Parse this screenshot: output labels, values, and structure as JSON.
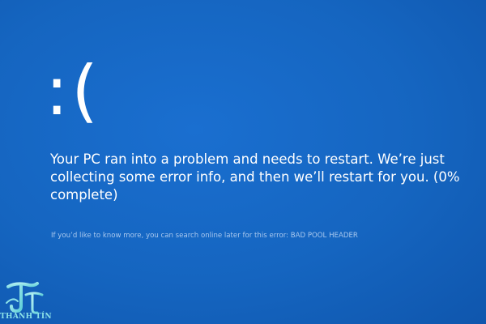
{
  "screen": {
    "background_color": "#1565c0",
    "face": ":(",
    "message_lines": [
      "Your PC ran into a problem and needs to restart. We’re just",
      "collecting some error info, and then we’ll restart for you. (0%",
      "complete)"
    ],
    "progress_percent": 0,
    "error_info": "If you’d like to know more, you can search online later for this error: BAD POOL HEADER"
  },
  "watermark": {
    "text": "THANH TÍN",
    "color": "#8de3e8"
  }
}
